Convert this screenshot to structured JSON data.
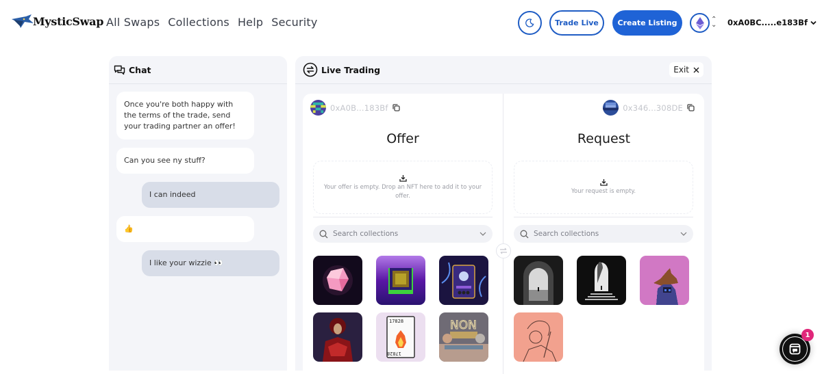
{
  "nav": {
    "brand": "MysticSwap",
    "links": [
      "All Swaps",
      "Collections",
      "Help",
      "Security"
    ],
    "trade_live_label": "Trade Live",
    "create_listing_label": "Create Listing",
    "wallet_address": "0xA0BC.....e183Bf",
    "chain": "ethereum"
  },
  "colors": {
    "accent": "#1f63d6",
    "panel_bg": "#f4f5f9",
    "badge": "#e0277a"
  },
  "chat": {
    "title": "Chat",
    "messages": [
      {
        "from": "partner",
        "text": "Once you're both happy with the terms of the trade, send your trading partner an offer!"
      },
      {
        "from": "partner",
        "text": "Can you see ny stuff?"
      },
      {
        "from": "me",
        "text": "I can indeed"
      },
      {
        "from": "partner",
        "text": "👍"
      },
      {
        "from": "me",
        "text": "I like your wizzie 👀"
      }
    ]
  },
  "trading": {
    "title": "Live Trading",
    "exit_label": "Exit",
    "offer": {
      "address": "0xA0B...183Bf",
      "title": "Offer",
      "empty_text": "Your offer is empty. Drop an NFT here to add it to your offer.",
      "search_placeholder": "Search collections",
      "nfts": [
        "pink-crystal",
        "purple-cube",
        "mystic-card",
        "red-warrior",
        "fire-card-17828",
        "non-fungible-sign"
      ]
    },
    "request": {
      "address": "0x346...308DE",
      "title": "Request",
      "empty_text": "Your request is empty.",
      "search_placeholder": "Search collections",
      "nfts": [
        "stone-archway",
        "light-portal",
        "pixel-wizard",
        "sketch-portrait"
      ]
    }
  },
  "fab": {
    "badge_count": "1"
  }
}
